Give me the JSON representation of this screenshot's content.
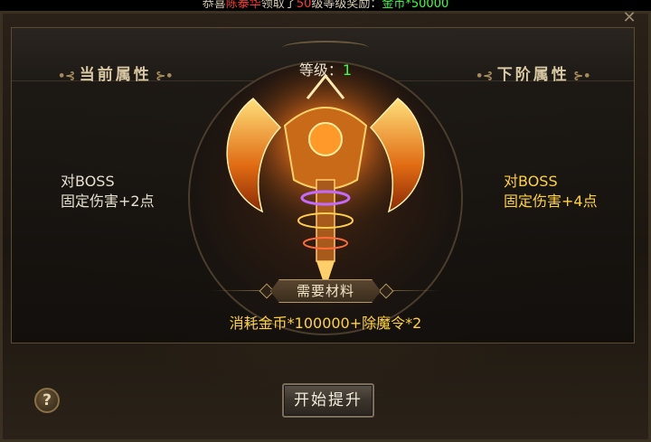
{
  "ticker": {
    "prefix": "恭喜",
    "player": "陈泰华",
    "mid": "领取了",
    "level": "50",
    "suffix": "级等级奖励：",
    "reward": "金币*50000"
  },
  "panel": {
    "current_title": "当前属性",
    "next_title": "下阶属性",
    "level_label": "等级：",
    "level_value": "1",
    "current_stat_line1": "对BOSS",
    "current_stat_line2": "固定伤害+2点",
    "next_stat_line1": "对BOSS",
    "next_stat_line2": "固定伤害+4点",
    "materials_label": "需要材料",
    "materials_text": "消耗金币*100000+除魔令*2",
    "start_button": "开始提升",
    "help_button": "?"
  },
  "colors": {
    "level_value": "#3cff3c",
    "next_stat": "#ffd23a",
    "materials_text": "#ffd23a",
    "ticker_player": "#ff3b2f",
    "ticker_reward": "#3cff3c"
  },
  "icons": {
    "help": "question-mark-icon",
    "close": "close-icon"
  }
}
